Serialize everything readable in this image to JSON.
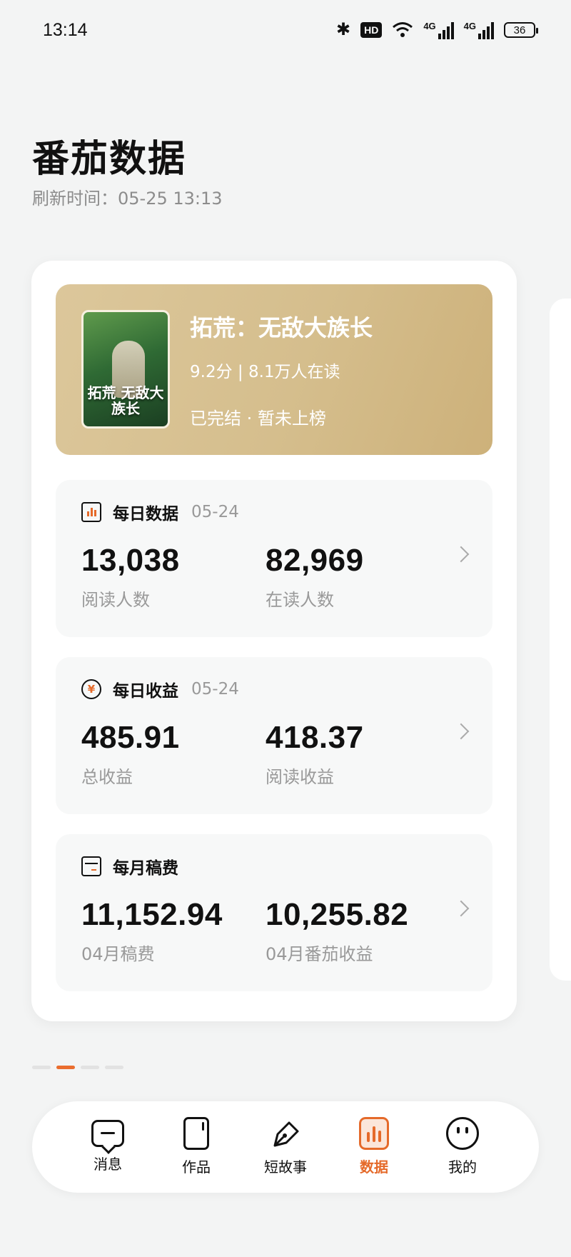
{
  "status_bar": {
    "time": "13:14",
    "hd_label": "HD",
    "network_label_1": "4G",
    "network_label_2": "4G",
    "battery": "36"
  },
  "header": {
    "title": "番茄数据",
    "refresh_label": "刷新时间：05-25 13:13"
  },
  "book": {
    "title": "拓荒：无敌大族长",
    "rating": "9.2分 | 8.1万人在读",
    "status": "已完结 · 暂未上榜",
    "cover_text": "拓荒 无敌大族长"
  },
  "daily_data": {
    "title": "每日数据",
    "date": "05-24",
    "icon": "bar-chart-icon",
    "value1": "13,038",
    "label1": "阅读人数",
    "value2": "82,969",
    "label2": "在读人数"
  },
  "daily_income": {
    "title": "每日收益",
    "date": "05-24",
    "icon": "yuan-coin-icon",
    "value1": "485.91",
    "label1": "总收益",
    "value2": "418.37",
    "label2": "阅读收益"
  },
  "monthly_fee": {
    "title": "每月稿费",
    "icon": "wallet-icon",
    "value1": "11,152.94",
    "label1": "04月稿费",
    "value2": "10,255.82",
    "label2": "04月番茄收益"
  },
  "pager": {
    "count": 4,
    "active_index": 1
  },
  "tabbar": {
    "items": [
      {
        "label": "消息",
        "icon": "message-icon"
      },
      {
        "label": "作品",
        "icon": "document-icon"
      },
      {
        "label": "短故事",
        "icon": "pen-icon"
      },
      {
        "label": "数据",
        "icon": "data-chart-icon",
        "active": true
      },
      {
        "label": "我的",
        "icon": "face-icon"
      }
    ],
    "active_color": "#e56a2a"
  },
  "colors": {
    "accent": "#e56a2a",
    "book_card": "#d5be8d",
    "background": "#f3f4f4"
  }
}
